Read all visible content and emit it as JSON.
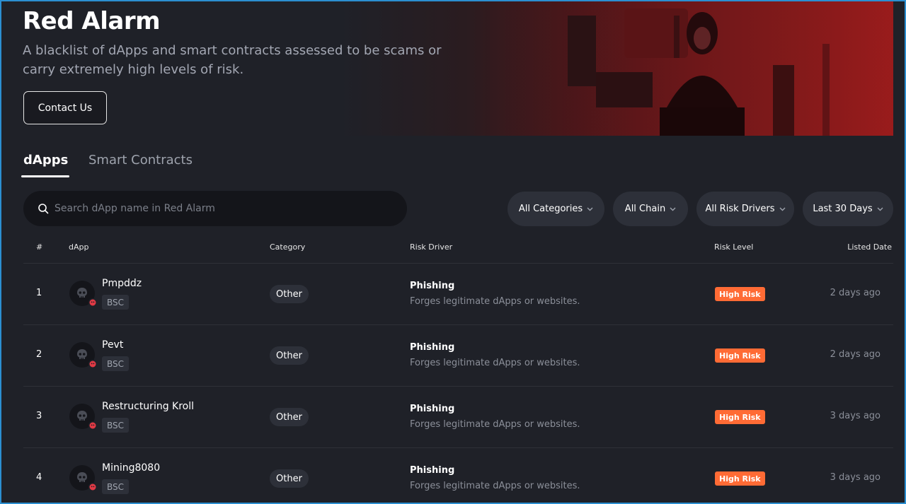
{
  "hero": {
    "title": "Red Alarm",
    "subtitle": "A blacklist of dApps and smart contracts assessed to be scams or carry extremely high levels of risk.",
    "contact_label": "Contact Us"
  },
  "tabs": [
    {
      "label": "dApps",
      "active": true
    },
    {
      "label": "Smart Contracts",
      "active": false
    }
  ],
  "search": {
    "placeholder": "Search dApp name in Red Alarm",
    "value": ""
  },
  "filters": {
    "category": "All Categories",
    "chain": "All Chain",
    "risk_drivers": "All Risk Drivers",
    "period": "Last 30 Days"
  },
  "table": {
    "headers": {
      "num": "#",
      "dapp": "dApp",
      "category": "Category",
      "risk_driver": "Risk Driver",
      "risk_level": "Risk Level",
      "listed_date": "Listed Date"
    },
    "rows": [
      {
        "num": "1",
        "name": "Pmpddz",
        "chain": "BSC",
        "category": "Other",
        "risk_driver": "Phishing",
        "risk_desc": "Forges legitimate dApps or websites.",
        "risk_level": "High Risk",
        "listed": "2 days ago"
      },
      {
        "num": "2",
        "name": "Pevt",
        "chain": "BSC",
        "category": "Other",
        "risk_driver": "Phishing",
        "risk_desc": "Forges legitimate dApps or websites.",
        "risk_level": "High Risk",
        "listed": "2 days ago"
      },
      {
        "num": "3",
        "name": "Restructuring Kroll",
        "chain": "BSC",
        "category": "Other",
        "risk_driver": "Phishing",
        "risk_desc": "Forges legitimate dApps or websites.",
        "risk_level": "High Risk",
        "listed": "3 days ago"
      },
      {
        "num": "4",
        "name": "Mining8080",
        "chain": "BSC",
        "category": "Other",
        "risk_driver": "Phishing",
        "risk_desc": "Forges legitimate dApps or websites.",
        "risk_level": "High Risk",
        "listed": "3 days ago"
      }
    ]
  },
  "colors": {
    "background": "#1f2128",
    "accent_red": "#8a1a1a",
    "risk_badge": "#ff6b35",
    "chip": "#2d3039"
  },
  "icons": {
    "search": "search-icon",
    "chevron": "chevron-down-icon",
    "avatar": "skull-icon",
    "badge": "danger-skull-icon"
  }
}
